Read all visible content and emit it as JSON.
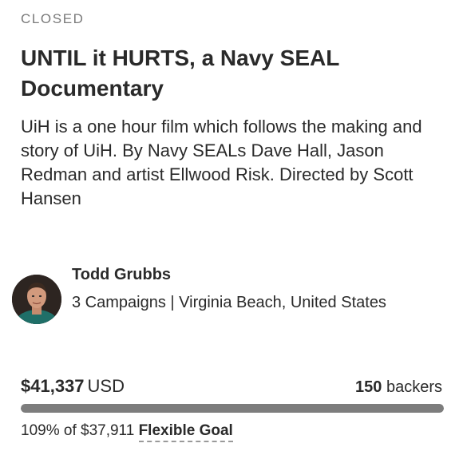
{
  "campaign": {
    "status": "CLOSED",
    "title": "UNTIL it HURTS, a Navy SEAL Documentary",
    "blurb": "UiH is a one hour film which follows the making and story of UiH. By Navy SEALs Dave Hall, Jason Redman and artist Ellwood Risk. Directed by Scott Hansen"
  },
  "owner": {
    "name": "Todd Grubbs",
    "meta": "3 Campaigns | Virginia Beach, United States",
    "avatar_icon": "profile-photo"
  },
  "funding": {
    "raised_amount": "$41,337",
    "currency": "USD",
    "backers_count": "150",
    "backers_label": "backers",
    "percent_text": "109% of $37,911",
    "goal_type": "Flexible Goal",
    "progress_fraction": 1.0
  },
  "colors": {
    "progress_fill": "#7d7d7d",
    "progress_track": "#e6e6e6",
    "text": "#2a2a2a",
    "status_text": "#7a7a7a"
  }
}
